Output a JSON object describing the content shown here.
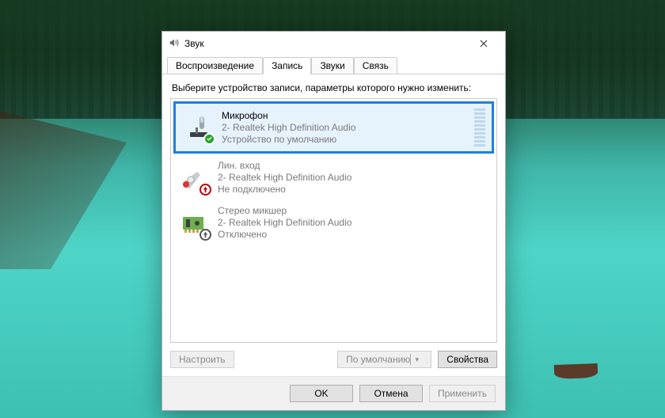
{
  "window": {
    "title": "Звук"
  },
  "tabs": {
    "items": [
      {
        "label": "Воспроизведение"
      },
      {
        "label": "Запись"
      },
      {
        "label": "Звуки"
      },
      {
        "label": "Связь"
      }
    ],
    "active_index": 1
  },
  "instruction": "Выберите устройство записи, параметры которого нужно изменить:",
  "devices": [
    {
      "name": "Микрофон",
      "subtitle": "2- Realtek High Definition Audio",
      "status": "Устройство по умолчанию",
      "icon": "microphone",
      "badge": "ok",
      "selected": true,
      "has_meter": true
    },
    {
      "name": "Лин. вход",
      "subtitle": "2- Realtek High Definition Audio",
      "status": "Не подключено",
      "icon": "line-in",
      "badge": "down",
      "selected": false,
      "has_meter": false
    },
    {
      "name": "Стерео микшер",
      "subtitle": "2- Realtek High Definition Audio",
      "status": "Отключено",
      "icon": "mixer",
      "badge": "off",
      "selected": false,
      "has_meter": false
    }
  ],
  "lower_buttons": {
    "configure": "Настроить",
    "set_default": "По умолчанию",
    "properties": "Свойства"
  },
  "dialog_buttons": {
    "ok": "OK",
    "cancel": "Отмена",
    "apply": "Применить"
  },
  "colors": {
    "selection_outline": "#1e7fe0",
    "selection_fill": "#e6f2fc"
  }
}
